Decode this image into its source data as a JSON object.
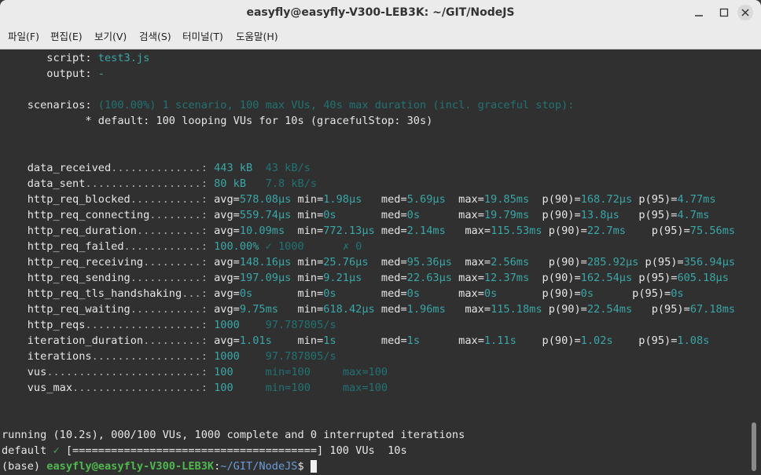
{
  "window": {
    "title": "easyfly@easyfly-V300-LEB3K: ~/GIT/NodeJS"
  },
  "menu": [
    "파일(F)",
    "편집(E)",
    "보기(V)",
    "검색(S)",
    "터미널(T)",
    "도움말(H)"
  ],
  "terminal": {
    "script_label": "script:",
    "script_value": "test3.js",
    "output_label": "output:",
    "output_value": "-",
    "scenarios_label": "scenarios:",
    "scenarios_value": "(100.00%) 1 scenario, 100 max VUs, 40s max duration (incl. graceful stop):",
    "scenario_default": "* default: 100 looping VUs for 10s (gracefulStop: 30s)",
    "data_received": {
      "name": "data_received",
      "dots": "..............:",
      "v1": "443 kB",
      "v2": "43 kB/s"
    },
    "data_sent": {
      "name": "data_sent",
      "dots": "..................:",
      "v1": "80 kB",
      "v2": "7.8 kB/s"
    },
    "http_req_blocked": {
      "name": "http_req_blocked",
      "dots": "...........:",
      "avg": "578.08µs",
      "min": "1.98µs",
      "med": "5.69µs",
      "max": "19.85ms",
      "p90": "168.72µs",
      "p95": "4.77ms"
    },
    "http_req_connecting": {
      "name": "http_req_connecting",
      "dots": "........:",
      "avg": "559.74µs",
      "min": "0s",
      "med": "0s",
      "max": "19.79ms",
      "p90": "13.8µs",
      "p95": "4.7ms"
    },
    "http_req_duration": {
      "name": "http_req_duration",
      "dots": "..........:",
      "avg": "10.09ms",
      "min": "772.13µs",
      "med": "2.14ms",
      "max": "115.53ms",
      "p90": "22.7ms",
      "p95": "75.56ms"
    },
    "http_req_failed": {
      "name": "http_req_failed",
      "dots": "............:",
      "v1": "100.00%",
      "v2": "✓ 1000",
      "v3": "✗ 0"
    },
    "http_req_receiving": {
      "name": "http_req_receiving",
      "dots": ".........:",
      "avg": "148.16µs",
      "min": "25.76µs",
      "med": "95.36µs",
      "max": "2.56ms",
      "p90": "285.92µs",
      "p95": "356.94µs"
    },
    "http_req_sending": {
      "name": "http_req_sending",
      "dots": "...........:",
      "avg": "197.09µs",
      "min": "9.21µs",
      "med": "22.63µs",
      "max": "12.37ms",
      "p90": "162.54µs",
      "p95": "605.18µs"
    },
    "http_req_tls_handshaking": {
      "name": "http_req_tls_handshaking",
      "dots": "...:",
      "avg": "0s",
      "min": "0s",
      "med": "0s",
      "max": "0s",
      "p90": "0s",
      "p95": "0s"
    },
    "http_req_waiting": {
      "name": "http_req_waiting",
      "dots": "...........:",
      "avg": "9.75ms",
      "min": "618.42µs",
      "med": "1.96ms",
      "max": "115.18ms",
      "p90": "22.54ms",
      "p95": "67.18ms"
    },
    "http_reqs": {
      "name": "http_reqs",
      "dots": "..................:",
      "v1": "1000",
      "v2": "97.787805/s"
    },
    "iteration_duration": {
      "name": "iteration_duration",
      "dots": ".........:",
      "avg": "1.01s",
      "min": "1s",
      "med": "1s",
      "max": "1.11s",
      "p90": "1.02s",
      "p95": "1.08s"
    },
    "iterations": {
      "name": "iterations",
      "dots": ".................:",
      "v1": "1000",
      "v2": "97.787805/s"
    },
    "vus": {
      "name": "vus",
      "dots": "........................:",
      "v1": "100",
      "v2": "min=100",
      "v3": "max=100"
    },
    "vus_max": {
      "name": "vus_max",
      "dots": "....................:",
      "v1": "100",
      "v2": "min=100",
      "v3": "max=100"
    },
    "running": "running (10.2s), 000/100 VUs, 1000 complete and 0 interrupted iterations",
    "progress_prefix": "default",
    "progress_check": "✓",
    "progress_bar": "[======================================]",
    "progress_suffix": "100 VUs  10s",
    "prompt_env": "(base)",
    "prompt_user": "easyfly@easyfly-V300-LEB3K",
    "prompt_path": "~/GIT/NodeJS",
    "prompt_symbol": "$"
  }
}
